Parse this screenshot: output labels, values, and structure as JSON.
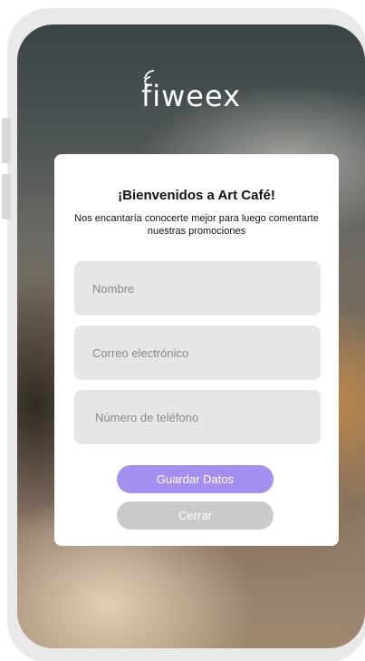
{
  "brand": {
    "logo_text": "fiweex"
  },
  "form": {
    "title": "¡Bienvenidos a Art Café!",
    "subtitle": "Nos encantaría conocerte mejor para luego comentarte nuestras promociones",
    "fields": {
      "name_placeholder": "Nombre",
      "email_placeholder": "Correo electrónico",
      "phone_placeholder": "Número de teléfono"
    },
    "buttons": {
      "save_label": "Guardar Datos",
      "close_label": "Cerrar"
    }
  },
  "colors": {
    "accent": "#a48ff0",
    "secondary_button": "#cacaca",
    "field_bg": "#e6e6e6"
  },
  "icons": [
    "wifi-signal-icon"
  ]
}
